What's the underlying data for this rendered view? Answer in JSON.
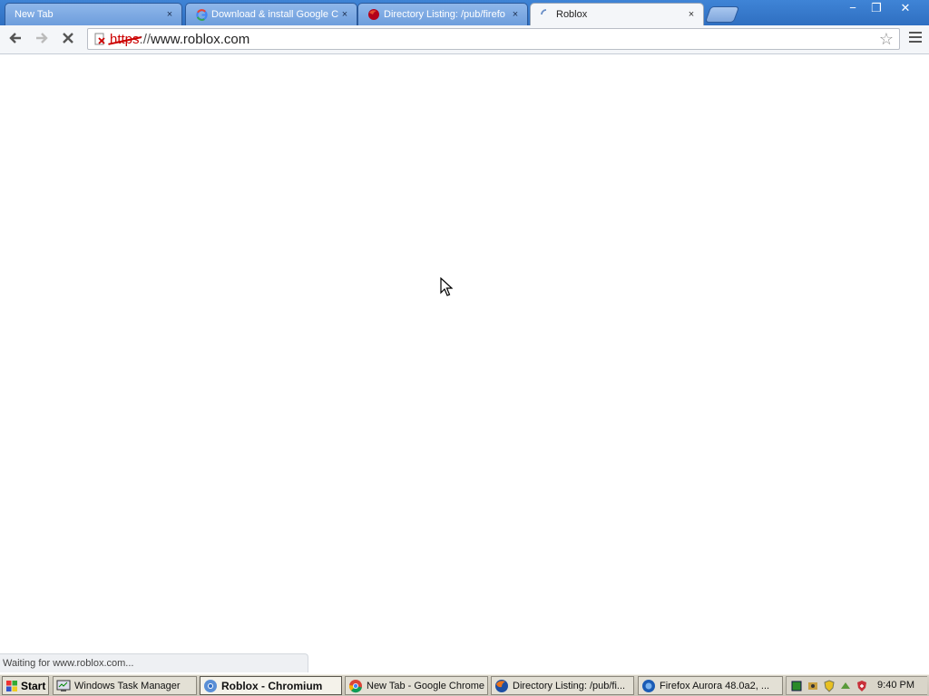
{
  "browser": {
    "tabs": [
      {
        "title": "New Tab",
        "icon": "none",
        "active": false
      },
      {
        "title": "Download & install Google Ch",
        "icon": "google-icon",
        "active": false
      },
      {
        "title": "Directory Listing: /pub/firefo",
        "icon": "firefox-icon",
        "active": false
      },
      {
        "title": "Roblox",
        "icon": "loading-spinner-icon",
        "active": true
      }
    ],
    "tab_close_glyph": "×",
    "window_controls": {
      "minimize": "−",
      "restore": "❐",
      "close": "✕"
    },
    "omnibox": {
      "scheme": "https",
      "separator": "://",
      "host": "www.roblox.com"
    },
    "status_text": "Waiting for www.roblox.com..."
  },
  "taskbar": {
    "start_label": "Start",
    "tasks": [
      {
        "label": "Windows Task Manager",
        "icon": "task-manager-icon",
        "active": false
      },
      {
        "label": "Roblox - Chromium",
        "icon": "chromium-icon",
        "active": true
      },
      {
        "label": "New Tab - Google Chrome",
        "icon": "chrome-icon",
        "active": false
      },
      {
        "label": "Directory Listing: /pub/fi...",
        "icon": "firefox-icon",
        "active": false
      },
      {
        "label": "Firefox Aurora 48.0a2, ...",
        "icon": "firefox-aurora-icon",
        "active": false
      }
    ],
    "clock": "9:40 PM"
  },
  "colors": {
    "titlebar": "#3f84d6",
    "insecure_red": "#cc0000",
    "taskbar": "#d4d0c8"
  }
}
